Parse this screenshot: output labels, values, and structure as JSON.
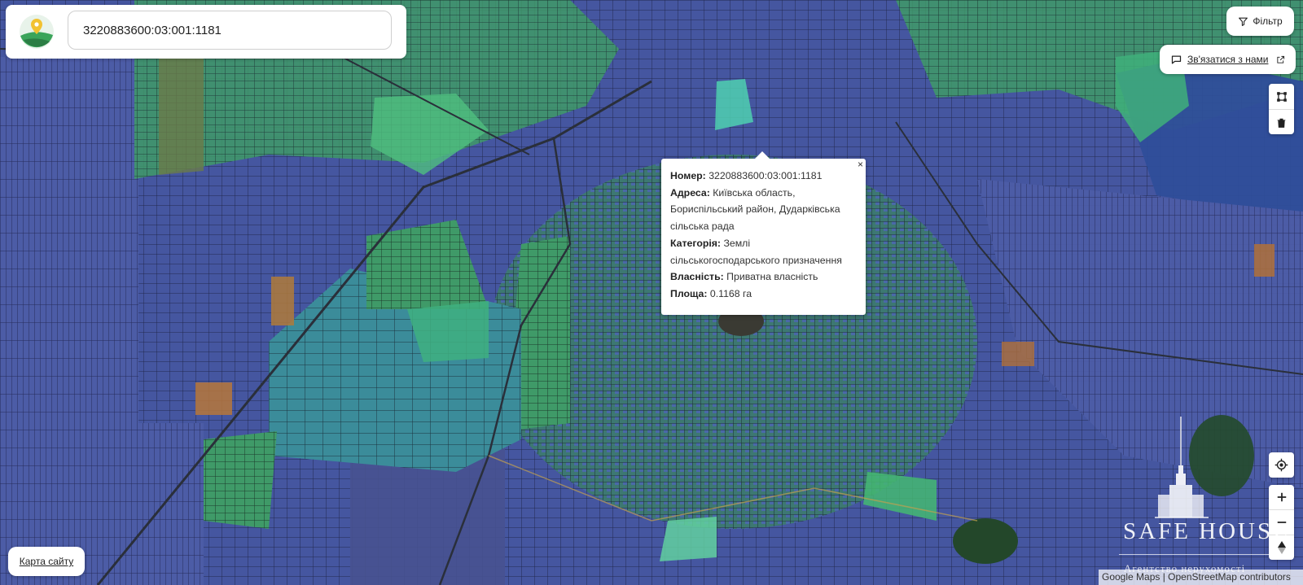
{
  "search": {
    "value": "3220883600:03:001:1181"
  },
  "header": {
    "filter_label": "Фільтр",
    "contact_label": "Зв'язатися з нами"
  },
  "footer": {
    "sitemap_label": "Карта сайту"
  },
  "popup": {
    "close": "×",
    "number_label": "Номер:",
    "number_value": "3220883600:03:001:1181",
    "address_label": "Адреса:",
    "address_value": "Київська область, Бориспільський район, Дударківська сільська рада",
    "category_label": "Категорія:",
    "category_value": "Землі сільськогосподарського призначення",
    "ownership_label": "Власність:",
    "ownership_value": "Приватна власність",
    "area_label": "Площа:",
    "area_value": "0.1168 га"
  },
  "watermark": {
    "name": "SAFE HOUSE",
    "tagline": "Агентство нерухомості"
  },
  "attribution": "Google Maps | OpenStreetMap contributors",
  "icons": {
    "filter": "filter-icon",
    "contact": "chat-icon",
    "external": "external-link-icon",
    "draw": "draw-polygon-icon",
    "trash": "trash-icon",
    "locate": "locate-icon",
    "zoom_in": "plus-icon",
    "zoom_out": "minus-icon",
    "compass": "compass-icon"
  },
  "colors": {
    "parcel_green": "#3fbf7a",
    "parcel_blue": "#4a5fb0",
    "parcel_teal": "#3aa0a0",
    "parcel_orange": "#c07a3a",
    "parcel_border": "#1a2030"
  }
}
